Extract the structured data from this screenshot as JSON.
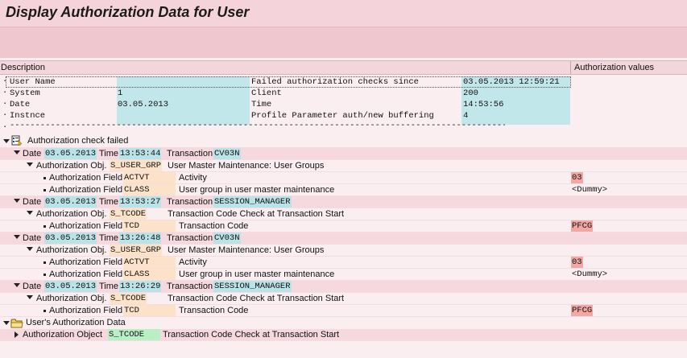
{
  "title": "Display Authorization Data for User",
  "columns": {
    "description": "Description",
    "values": "Authorization values"
  },
  "info": {
    "user_name": "User Name",
    "failed_checks": "Failed authorization checks since",
    "failed_checks_value": "03.05.2013 12:59:21",
    "system": "System",
    "system_value": "1",
    "client": "Client",
    "client_value": "200",
    "date": "Date",
    "date_value": "03.05.2013",
    "time": "Time",
    "time_value": "14:53:56",
    "instance": "Instnce",
    "profile_param": "Profile Parameter auth/new buffering",
    "profile_param_value": "4",
    "separator": "--------------------------------------------------------------------------------------------------------------"
  },
  "failed": {
    "label": "Authorization check failed",
    "date_label": "Date",
    "time_label": "Time",
    "transaction_label": "Transaction",
    "obj_label": "Authorization Obj.",
    "field_label": "Authorization Field",
    "entries": [
      {
        "date": "03.05.2013",
        "time": "13:53:44",
        "transaction": "CV03N",
        "object": "S_USER_GRP",
        "object_text": "User Master Maintenance: User Groups",
        "fields": [
          {
            "name": "ACTVT",
            "text": "Activity",
            "value": "03"
          },
          {
            "name": "CLASS",
            "text": "User group in user master maintenance",
            "value": "<Dummy>"
          }
        ]
      },
      {
        "date": "03.05.2013",
        "time": "13:53:27",
        "transaction": "SESSION_MANAGER",
        "object": "S_TCODE",
        "object_text": "Transaction Code Check at Transaction Start",
        "fields": [
          {
            "name": "TCD",
            "text": "Transaction Code",
            "value": "PFCG"
          }
        ]
      },
      {
        "date": "03.05.2013",
        "time": "13:26:48",
        "transaction": "CV03N",
        "object": "S_USER_GRP",
        "object_text": "User Master Maintenance: User Groups",
        "fields": [
          {
            "name": "ACTVT",
            "text": "Activity",
            "value": "03"
          },
          {
            "name": "CLASS",
            "text": "User group in user master maintenance",
            "value": "<Dummy>"
          }
        ]
      },
      {
        "date": "03.05.2013",
        "time": "13:26:29",
        "transaction": "SESSION_MANAGER",
        "object": "S_TCODE",
        "object_text": "Transaction Code Check at Transaction Start",
        "fields": [
          {
            "name": "TCD",
            "text": "Transaction Code",
            "value": "PFCG"
          }
        ]
      }
    ]
  },
  "user_auth": {
    "label": "User's Authorization Data",
    "object_label": "Authorization Object",
    "object": "S_TCODE",
    "object_text": "Transaction Code Check at Transaction Start"
  }
}
